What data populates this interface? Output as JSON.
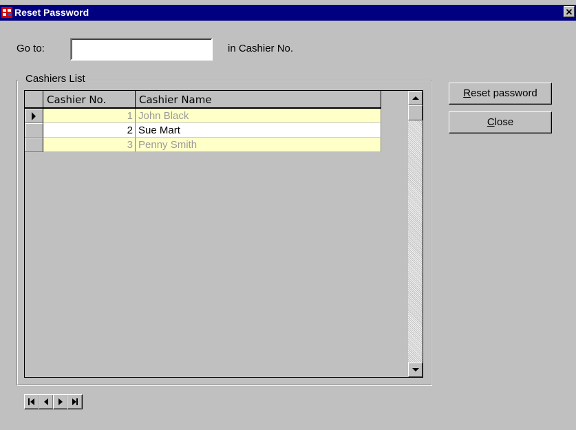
{
  "window": {
    "title": "Reset Password",
    "close_glyph": "✕",
    "icon": "app-grid-icon"
  },
  "goto": {
    "label": "Go to:",
    "value": "",
    "suffix": "in Cashier No."
  },
  "group": {
    "title": "Cashiers List"
  },
  "grid": {
    "columns": [
      "Cashier No.",
      "Cashier Name"
    ],
    "rows": [
      {
        "no": "1",
        "name": "John Black",
        "current": true
      },
      {
        "no": "2",
        "name": "Sue Mart",
        "current": false
      },
      {
        "no": "3",
        "name": "Penny Smith",
        "current": false
      }
    ]
  },
  "buttons": {
    "reset": {
      "hotkey": "R",
      "rest": "eset password"
    },
    "close": {
      "hotkey": "C",
      "rest": "lose"
    }
  },
  "navigator": [
    "first-record-icon",
    "prev-record-icon",
    "next-record-icon",
    "last-record-icon"
  ],
  "colors": {
    "titlebar": "#000080",
    "alt_row": "#ffffc8",
    "face": "#c0c0c0"
  }
}
